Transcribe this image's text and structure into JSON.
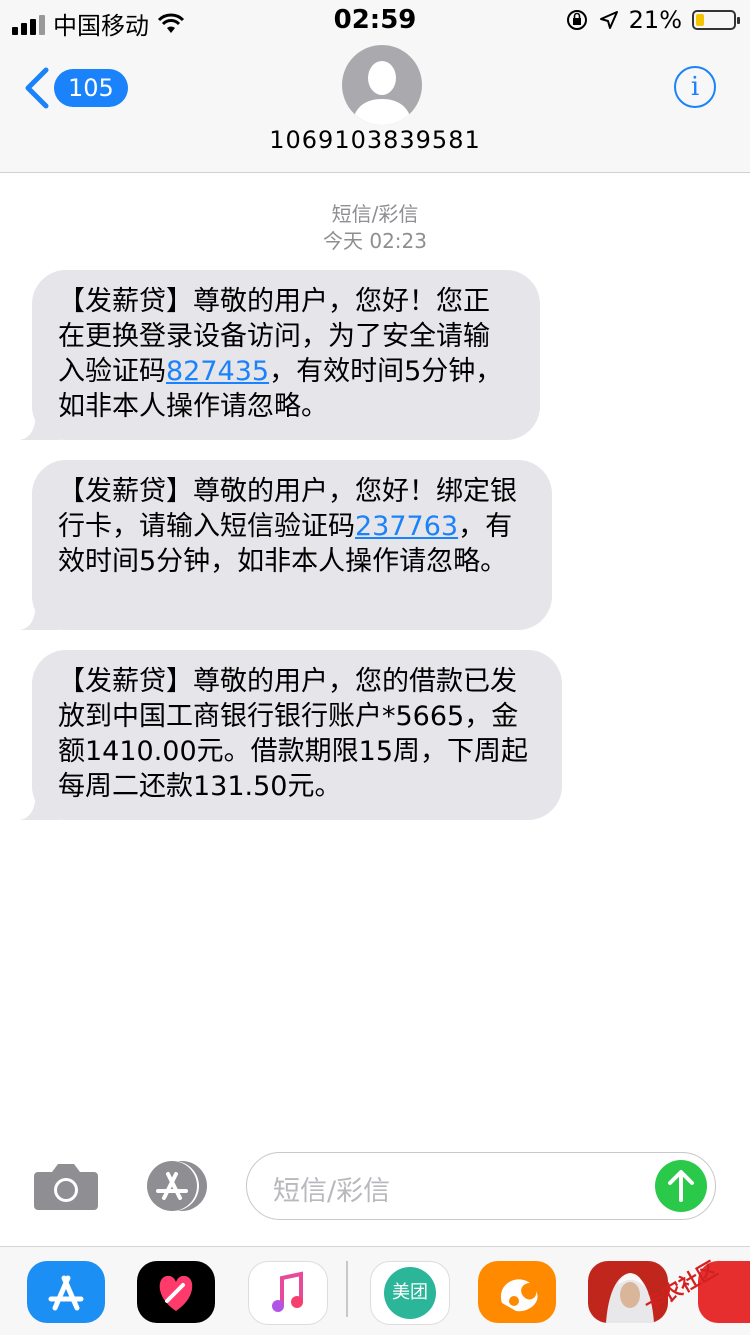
{
  "status_bar": {
    "carrier": "中国移动",
    "time": "02:59",
    "battery": "21%",
    "battery_level": 0.21
  },
  "header": {
    "back_badge": "105",
    "contact": "1069103839581",
    "info_icon": "info-icon"
  },
  "thread": {
    "type_label": "短信/彩信",
    "timestamp": "今天 02:23"
  },
  "messages": [
    {
      "before": "【发薪贷】尊敬的用户，您好！您正在更换登录设备访问，为了安全请输入验证码",
      "code": "827435",
      "after": "，有效时间5分钟，如非本人操作请忽略。"
    },
    {
      "before": "【发薪贷】尊敬的用户，您好！绑定银行卡，请输入短信验证码",
      "code": "237763",
      "after": "，有效时间5分钟，如非本人操作请忽略。"
    },
    {
      "text": "【发薪贷】尊敬的用户，您的借款已发放到中国工商银行银行账户*5665，金额1410.00元。借款期限15周，下周起每周二还款131.50元。"
    }
  ],
  "input": {
    "placeholder": "短信/彩信"
  },
  "dock": {
    "meituan": "美团",
    "watermark": "卡农社区"
  },
  "colors": {
    "accent": "#1a82fb",
    "bubble": "#e5e5ea",
    "send": "#2bc94a"
  }
}
